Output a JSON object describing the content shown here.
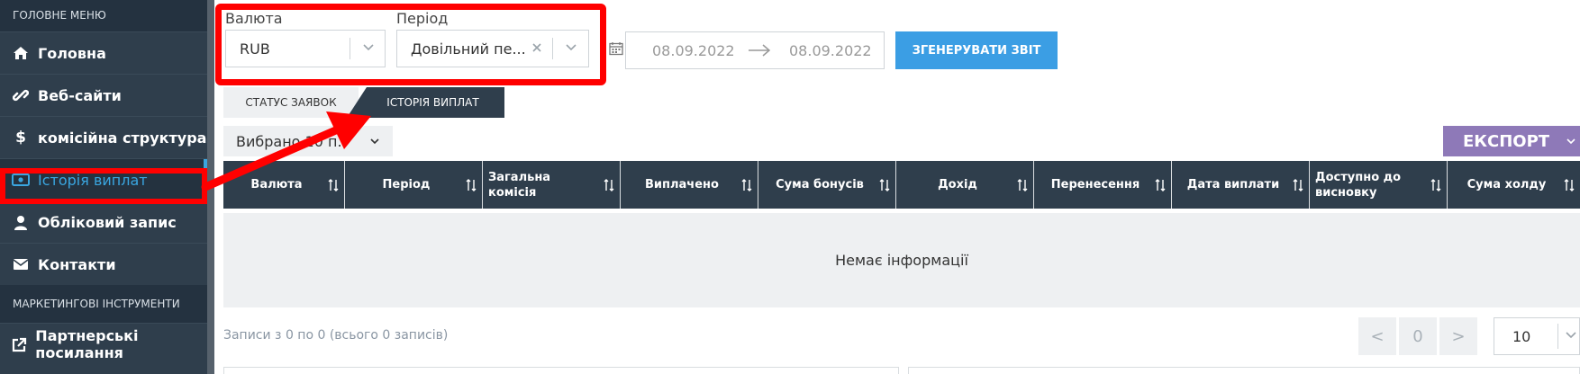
{
  "sidebar": {
    "main_menu_header": "ГОЛОВНЕ МЕНЮ",
    "items": [
      {
        "label": "Головна",
        "icon": "home-icon"
      },
      {
        "label": "Веб-сайти",
        "icon": "link-icon"
      },
      {
        "label": "комісійна структура",
        "icon": "dollar-icon"
      },
      {
        "label": "Історія виплат",
        "icon": "money-icon",
        "active": true
      },
      {
        "label": "Обліковий запис",
        "icon": "user-icon"
      },
      {
        "label": "Контакти",
        "icon": "envelope-icon"
      }
    ],
    "marketing_header": "МАРКЕТИНГОВІ ІНСТРУМЕНТИ",
    "marketing_items": [
      {
        "label": "Партнерські посилання",
        "icon": "external-link-icon"
      }
    ]
  },
  "filters": {
    "currency_label": "Валюта",
    "currency_value": "RUB",
    "period_label": "Період",
    "period_value": "Довільний пе...",
    "date_from": "08.09.2022",
    "date_to": "08.09.2022",
    "generate_button": "ЗГЕНЕРУВАТИ ЗВІТ"
  },
  "tabs": [
    {
      "label": "СТАТУС ЗАЯВОК",
      "active": false
    },
    {
      "label": "ІСТОРІЯ ВИПЛАТ",
      "active": true
    }
  ],
  "toolbar": {
    "chosen_label": "Вибрано 10 п.",
    "export_button": "ЕКСПОРТ"
  },
  "table": {
    "columns": [
      "Валюта",
      "Період",
      "Загальна комісія",
      "Виплачено",
      "Сума бонусів",
      "Дохід",
      "Перенесення",
      "Дата виплати",
      "Доступно до висновку",
      "Сума холду"
    ],
    "empty_text": "Немає інформації"
  },
  "footer": {
    "records_text": "Записи з 0 по 0 (всього 0 записів)",
    "prev": "<",
    "page": "0",
    "next": ">",
    "per_page": "10"
  },
  "colors": {
    "sidebar_bg": "#2f3e4c",
    "accent_blue": "#3b9ee4",
    "export_purple": "#8e79b8",
    "annotation_red": "#ff0000"
  }
}
